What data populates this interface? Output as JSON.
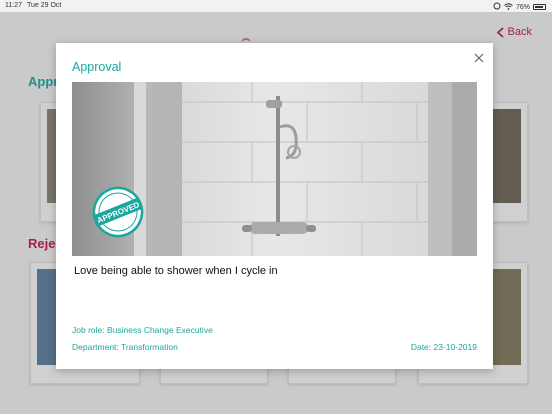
{
  "status_bar": {
    "time": "11:27",
    "date": "Tue 29 Oct",
    "battery": "76%"
  },
  "nav": {
    "back_label": "Back"
  },
  "background": {
    "approved_title": "Appro",
    "rejected_title": "Rejec"
  },
  "modal": {
    "title": "Approval",
    "stamp_text": "APPROVED",
    "caption": "Love being able to shower when I cycle in",
    "job_role": "Job role: Business Change Executive",
    "department": "Department: Transformation",
    "date": "Date: 23-10-2019"
  },
  "colors": {
    "accent_teal": "#1aa7a0",
    "accent_magenta": "#c2185b"
  }
}
